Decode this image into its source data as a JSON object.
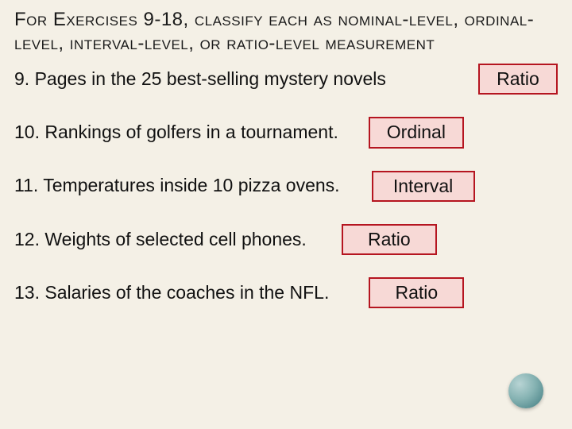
{
  "title": "For Exercises 9-18, classify each as nominal-level, ordinal-level, interval-level, or ratio-level measurement",
  "questions": [
    {
      "q": "9. Pages in the 25 best-selling mystery novels",
      "a": "Ratio"
    },
    {
      "q": "10. Rankings of golfers in a tournament.",
      "a": "Ordinal"
    },
    {
      "q": "11. Temperatures inside 10 pizza ovens.",
      "a": "Interval"
    },
    {
      "q": "12. Weights of selected cell phones.",
      "a": "Ratio"
    },
    {
      "q": "13. Salaries of the coaches in the NFL.",
      "a": "Ratio"
    }
  ]
}
